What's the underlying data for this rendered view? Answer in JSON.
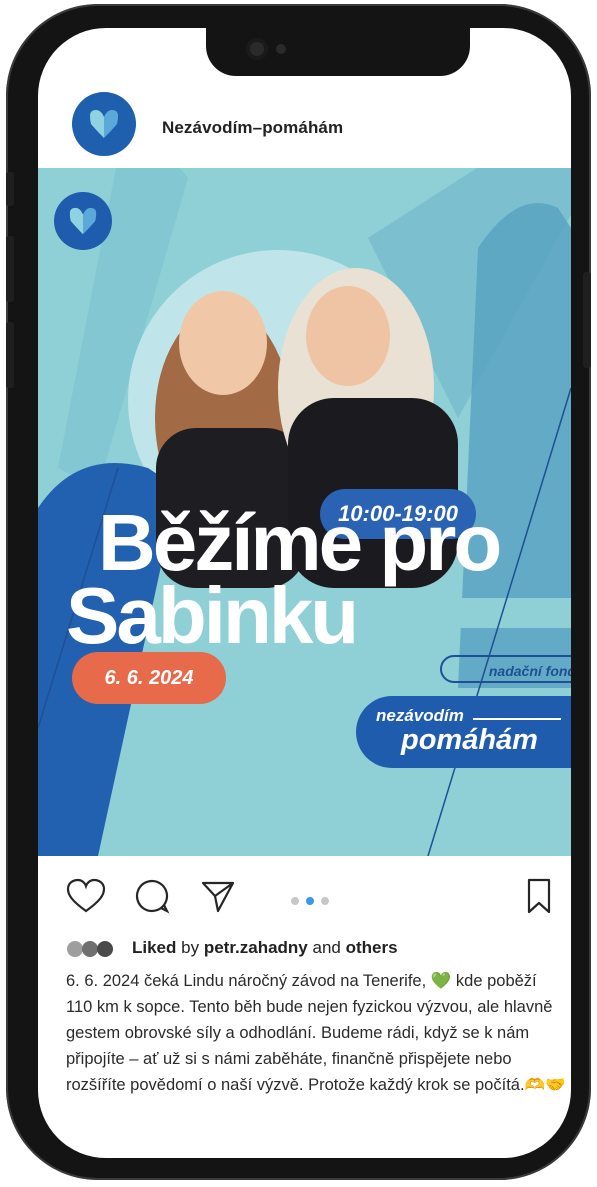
{
  "account": {
    "name": "Nezávodím–pomáhám"
  },
  "post": {
    "time": "10:00-19:00",
    "title_line1": "Běžíme pro",
    "title_line2": "Sabinku",
    "date": "6. 6. 2024",
    "fund_label": "nadační fond",
    "brand_line1": "nezávodím",
    "brand_line2": "pomáhám",
    "colors": {
      "background": "#8fcfd6",
      "primary_blue": "#1f5cae",
      "date_orange": "#e76a4a"
    }
  },
  "actions": {
    "icons": [
      "heart-icon",
      "comment-icon",
      "share-icon",
      "bookmark-icon"
    ],
    "carousel_dots": 3,
    "active_dot": 2
  },
  "likes": {
    "prefix": "Liked",
    "by": "by",
    "user": "petr.zahadny",
    "and": "and",
    "others": "others"
  },
  "caption": "6. 6. 2024 čeká Lindu náročný závod na Tenerife, 💚 kde poběží 110 km k sopce. Tento běh bude nejen fyzickou výzvou, ale hlavně gestem obrovské síly a odhodlání. Budeme rádi, když se k nám připojíte – ať už si s námi zaběháte, finančně přispějete nebo rozšíříte povědomí o naší výzvě. Protože každý krok se počítá.🫶🤝"
}
